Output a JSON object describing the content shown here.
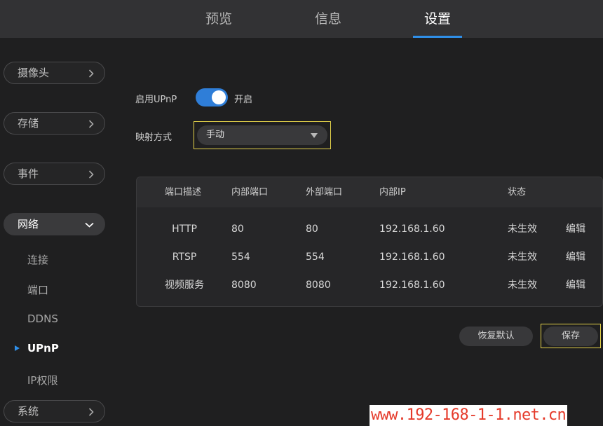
{
  "top_tabs": [
    {
      "label": "预览"
    },
    {
      "label": "信息"
    },
    {
      "label": "设置",
      "active": true
    }
  ],
  "sidebar": {
    "camera": "摄像头",
    "storage": "存储",
    "event": "事件",
    "network": {
      "label": "网络",
      "items": [
        "连接",
        "端口",
        "DDNS",
        "UPnP",
        "IP权限"
      ],
      "active_item": "UPnP"
    },
    "system": "系统"
  },
  "form": {
    "enable_upnp_label": "启用UPnP",
    "enable_upnp_state": "开启",
    "enable_upnp_on": true,
    "mapping_label": "映射方式",
    "mapping_value": "手动"
  },
  "table": {
    "headers": [
      "端口描述",
      "内部端口",
      "外部端口",
      "内部IP",
      "状态"
    ],
    "rows": [
      {
        "desc": "HTTP",
        "internal": "80",
        "external": "80",
        "ip": "192.168.1.60",
        "status": "未生效",
        "action": "编辑"
      },
      {
        "desc": "RTSP",
        "internal": "554",
        "external": "554",
        "ip": "192.168.1.60",
        "status": "未生效",
        "action": "编辑"
      },
      {
        "desc": "视频服务",
        "internal": "8080",
        "external": "8080",
        "ip": "192.168.1.60",
        "status": "未生效",
        "action": "编辑"
      }
    ]
  },
  "buttons": {
    "restore": "恢复默认",
    "save": "保存"
  },
  "watermark": "www.192-168-1-1.net.cn",
  "colors": {
    "accent": "#2f8fe8",
    "highlight_border": "#e5d34a",
    "watermark": "#e53a2a"
  }
}
